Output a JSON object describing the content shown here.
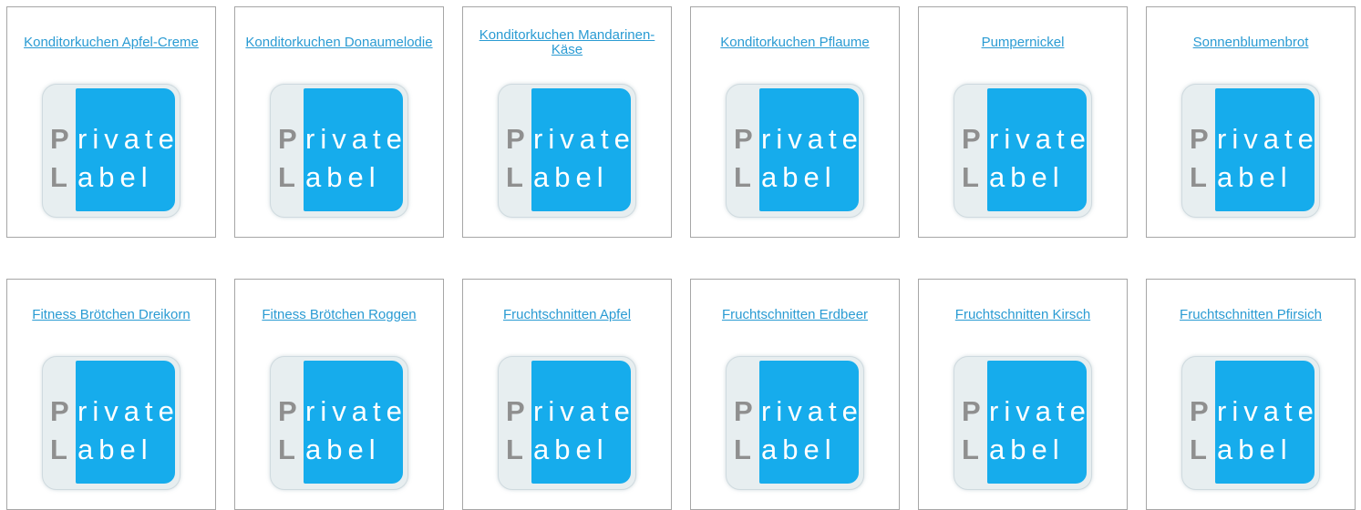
{
  "products": [
    {
      "title": "Konditorkuchen Apfel-Creme",
      "logo": {
        "line1_cap": "P",
        "line1_rest": "rivate",
        "line2_cap": "L",
        "line2_rest": "abel"
      }
    },
    {
      "title": "Konditorkuchen Donaumelodie",
      "logo": {
        "line1_cap": "P",
        "line1_rest": "rivate",
        "line2_cap": "L",
        "line2_rest": "abel"
      }
    },
    {
      "title": "Konditorkuchen Mandarinen-Käse ",
      "logo": {
        "line1_cap": "P",
        "line1_rest": "rivate",
        "line2_cap": "L",
        "line2_rest": "abel"
      }
    },
    {
      "title": "Konditorkuchen Pflaume",
      "logo": {
        "line1_cap": "P",
        "line1_rest": "rivate",
        "line2_cap": "L",
        "line2_rest": "abel"
      }
    },
    {
      "title": "Pumpernickel",
      "logo": {
        "line1_cap": "P",
        "line1_rest": "rivate",
        "line2_cap": "L",
        "line2_rest": "abel"
      }
    },
    {
      "title": "Sonnenblumenbrot",
      "logo": {
        "line1_cap": "P",
        "line1_rest": "rivate",
        "line2_cap": "L",
        "line2_rest": "abel"
      }
    },
    {
      "title": "Fitness Brötchen Dreikorn",
      "logo": {
        "line1_cap": "P",
        "line1_rest": "rivate",
        "line2_cap": "L",
        "line2_rest": "abel"
      }
    },
    {
      "title": "Fitness Brötchen Roggen",
      "logo": {
        "line1_cap": "P",
        "line1_rest": "rivate",
        "line2_cap": "L",
        "line2_rest": "abel"
      }
    },
    {
      "title": "Fruchtschnitten Apfel",
      "logo": {
        "line1_cap": "P",
        "line1_rest": "rivate",
        "line2_cap": "L",
        "line2_rest": "abel"
      }
    },
    {
      "title": "Fruchtschnitten Erdbeer",
      "logo": {
        "line1_cap": "P",
        "line1_rest": "rivate",
        "line2_cap": "L",
        "line2_rest": "abel"
      }
    },
    {
      "title": "Fruchtschnitten Kirsch",
      "logo": {
        "line1_cap": "P",
        "line1_rest": "rivate",
        "line2_cap": "L",
        "line2_rest": "abel"
      }
    },
    {
      "title": "Fruchtschnitten Pfirsich",
      "logo": {
        "line1_cap": "P",
        "line1_rest": "rivate",
        "line2_cap": "L",
        "line2_rest": "abel"
      }
    }
  ],
  "colors": {
    "link": "#2a9bd3",
    "card_border": "#a6a6a6",
    "logo_blue": "#16acec",
    "logo_grey_letter": "#8f8f8f",
    "logo_bg": "#e7eef0"
  }
}
